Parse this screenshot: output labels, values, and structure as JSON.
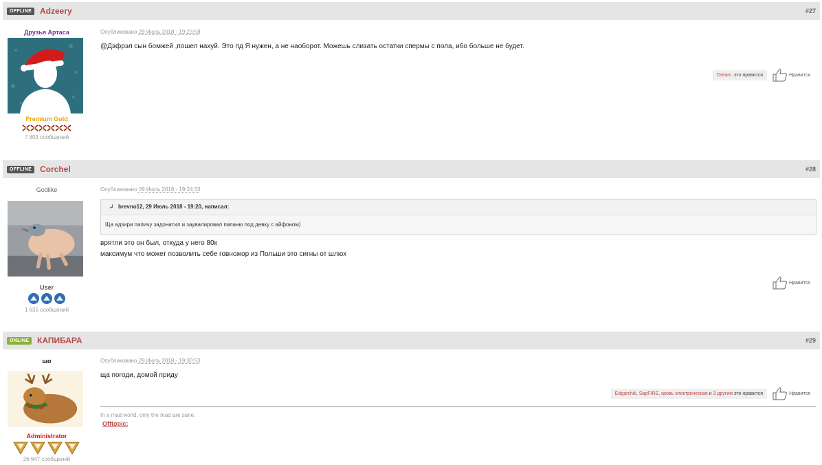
{
  "posts": [
    {
      "status": "OFFLINE",
      "author": "Adzeery",
      "number": "#27",
      "user_title": "Друзья Артаса",
      "rank": "Premium Gold",
      "messages": "7 803 сообщений",
      "published_label": "Опубликовано",
      "published_date": "29 Июль 2018 - 19:23:58",
      "text": "@Дэфрэл сын бомжей ,пошел нахуй. Это пд Я нужен, а не наоборот. Можешь слизать остатки спермы с пола, ибо больше не будет.",
      "likers": [
        "Dream."
      ],
      "likes_suffix": "это нравится",
      "like_label": "Нравится"
    },
    {
      "status": "OFFLINE",
      "author": "Corchel",
      "number": "#28",
      "user_title": "Godlike",
      "rank": "User",
      "messages": "1 635 сообщений",
      "published_label": "Опубликовано",
      "published_date": "29 Июль 2018 - 19:24:33",
      "quote_header": "brevno12, 29 Июль 2018 - 19:20, написал:",
      "quote_text": "Ща адзири папичу задонатил и заувалировал папаню под девку с айфоном)",
      "text_lines": [
        "врятли это он был, откуда у него 80к",
        "максимум что может позволить себе говножор из Польши это сигны от шлюх"
      ],
      "like_label": "Нравится"
    },
    {
      "status": "ONLINE",
      "author": "КАПИБАРА",
      "number": "#29",
      "user_title": "шо",
      "rank": "Administrator",
      "messages": "26 647 сообщений",
      "published_label": "Опубликовано",
      "published_date": "29 Июль 2018 - 19:30:53",
      "text": "ща погоди, домой приду",
      "likers": [
        "Edgarchik",
        "SapFIRE",
        "кровь электрическая"
      ],
      "likers_and": "и",
      "likers_others": "3 другим",
      "likes_suffix": "это нравится",
      "like_label": "Нравится",
      "signature": "In a mad world, only the mad are sane.",
      "sig_link": "Offtopic:"
    }
  ],
  "colors": {
    "author": "#b84a47",
    "rank_gold": "#f0a500",
    "rank_admin": "#e01010",
    "title_purple": "#7b2fa8"
  }
}
